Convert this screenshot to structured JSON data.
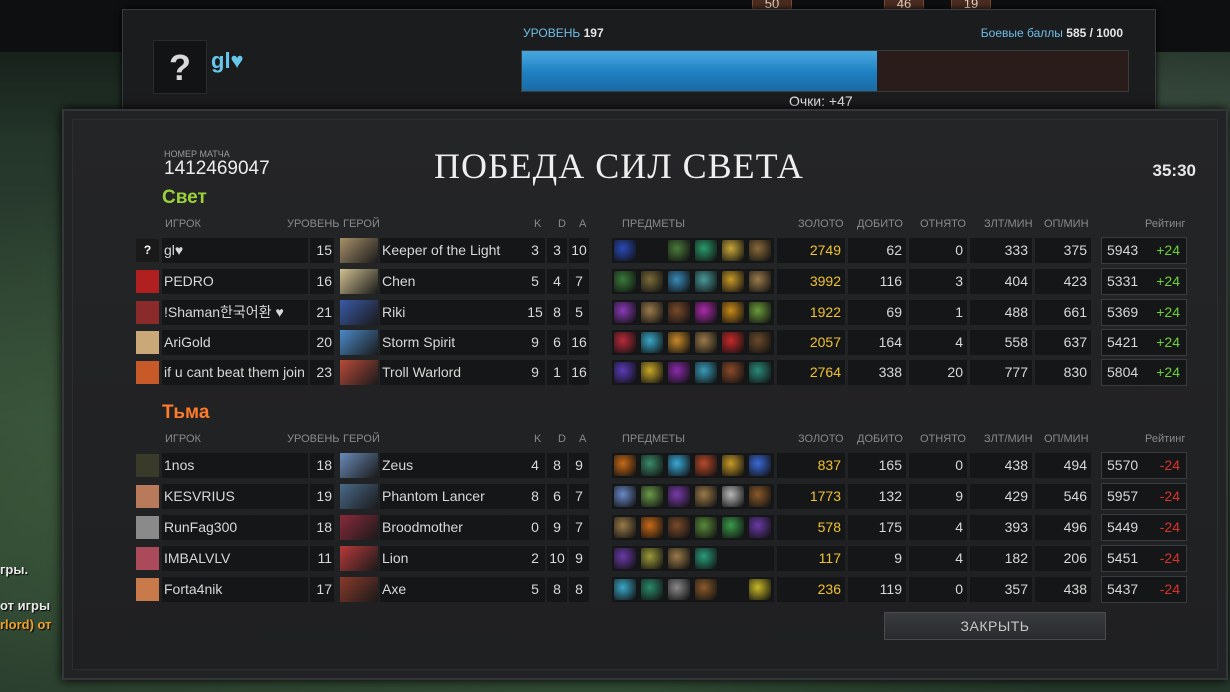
{
  "chat": {
    "lines": [
      "гры.",
      "от игры",
      "rlord) от"
    ]
  },
  "top_badges": [
    "50",
    "46",
    "19"
  ],
  "profile": {
    "avatar_glyph": "?",
    "name": "gl♥",
    "level_label": "УРОВЕНЬ",
    "level_value": "197",
    "battle_label": "Боевые баллы",
    "battle_value": "585 / 1000",
    "xp_progress": 0.585,
    "points_text": "Очки: +47"
  },
  "match": {
    "id_caption": "НОМЕР МАТЧА",
    "id": "1412469047",
    "title": "ПОБЕДА СИЛ СВЕТА",
    "duration": "35:30"
  },
  "columns": {
    "player": "ИГРОК",
    "level": "УРОВЕНЬ",
    "hero": "ГЕРОЙ",
    "k": "K",
    "d": "D",
    "a": "A",
    "items": "ПРЕДМЕТЫ",
    "gold": "ЗОЛОТО",
    "last_hits": "ДОБИТО",
    "denies": "ОТНЯТО",
    "gpm": "ЗЛТ/МИН",
    "xpm": "ОП/МИН",
    "rating": "Рейтинг"
  },
  "radiant": {
    "title": "Свет",
    "players": [
      {
        "avatar": "?",
        "name": "gl♥",
        "level": "15",
        "hero": "Keeper of the Light",
        "k": "3",
        "d": "3",
        "a": "10",
        "gold": "2749",
        "lh": "62",
        "dn": "0",
        "gpm": "333",
        "xpm": "375",
        "rating": "5943",
        "delta": "+24",
        "avatar_color": "#1a1a1a",
        "hero_color": "#a8906a",
        "items": [
          "#2a4ab8",
          "",
          "#4a7a3a",
          "#2a9a6a",
          "#c8a838",
          "#8a6a3a"
        ]
      },
      {
        "avatar": "",
        "name": "PEDRO",
        "level": "16",
        "hero": "Chen",
        "k": "5",
        "d": "4",
        "a": "7",
        "gold": "3992",
        "lh": "116",
        "dn": "3",
        "gpm": "404",
        "xpm": "423",
        "rating": "5331",
        "delta": "+24",
        "avatar_color": "#b02020",
        "hero_color": "#d0c090",
        "items": [
          "#3a7a3a",
          "#7a6a3a",
          "#3a8ab8",
          "#4a9a9a",
          "#c89a28",
          "#9a7a4a"
        ]
      },
      {
        "avatar": "",
        "name": "!Shaman한국어환 ♥",
        "level": "21",
        "hero": "Riki",
        "k": "15",
        "d": "8",
        "a": "5",
        "gold": "1922",
        "lh": "69",
        "dn": "1",
        "gpm": "488",
        "xpm": "661",
        "rating": "5369",
        "delta": "+24",
        "avatar_color": "#8a2a2a",
        "hero_color": "#3a5aa8",
        "items": [
          "#8a3ab8",
          "#9a7a4a",
          "#7a4a2a",
          "#aa2aaa",
          "#c88a18",
          "#6a9a3a"
        ]
      },
      {
        "avatar": "",
        "name": "AriGold",
        "level": "20",
        "hero": "Storm Spirit",
        "k": "9",
        "d": "6",
        "a": "16",
        "gold": "2057",
        "lh": "164",
        "dn": "4",
        "gpm": "558",
        "xpm": "637",
        "rating": "5421",
        "delta": "+24",
        "avatar_color": "#caa878",
        "hero_color": "#4a8ac8",
        "items": [
          "#b82a3a",
          "#3aa8c8",
          "#c88a28",
          "#9a7a4a",
          "#c82a2a",
          "#6a4a2a"
        ]
      },
      {
        "avatar": "",
        "name": "if u cant beat them join",
        "level": "23",
        "hero": "Troll Warlord",
        "k": "9",
        "d": "1",
        "a": "16",
        "gold": "2764",
        "lh": "338",
        "dn": "20",
        "gpm": "777",
        "xpm": "830",
        "rating": "5804",
        "delta": "+24",
        "avatar_color": "#c85a2a",
        "hero_color": "#b84a3a",
        "items": [
          "#5a3ab8",
          "#c8a828",
          "#8a2aaa",
          "#3a9ab8",
          "#8a4a2a",
          "#2a8a7a"
        ]
      }
    ]
  },
  "dire": {
    "title": "Тьма",
    "players": [
      {
        "avatar": "",
        "name": "1nos",
        "level": "18",
        "hero": "Zeus",
        "k": "4",
        "d": "8",
        "a": "9",
        "gold": "837",
        "lh": "165",
        "dn": "0",
        "gpm": "438",
        "xpm": "494",
        "rating": "5570",
        "delta": "-24",
        "avatar_color": "#3a3a2a",
        "hero_color": "#6a8ab8",
        "items": [
          "#c86a18",
          "#3a8a6a",
          "#3aa8d8",
          "#b84a2a",
          "#c89a28",
          "#3a6ad8"
        ]
      },
      {
        "avatar": "",
        "name": "KESVRIUS",
        "level": "19",
        "hero": "Phantom Lancer",
        "k": "8",
        "d": "6",
        "a": "7",
        "gold": "1773",
        "lh": "132",
        "dn": "9",
        "gpm": "429",
        "xpm": "546",
        "rating": "5957",
        "delta": "-24",
        "avatar_color": "#b87a5a",
        "hero_color": "#4a6a8a",
        "items": [
          "#6a8ac8",
          "#6a9a4a",
          "#7a3aaa",
          "#9a7a4a",
          "#b8b8b8",
          "#8a5a2a"
        ]
      },
      {
        "avatar": "",
        "name": "RunFag300",
        "level": "18",
        "hero": "Broodmother",
        "k": "0",
        "d": "9",
        "a": "7",
        "gold": "578",
        "lh": "175",
        "dn": "4",
        "gpm": "393",
        "xpm": "496",
        "rating": "5449",
        "delta": "-24",
        "avatar_color": "#8a8a8a",
        "hero_color": "#8a2a3a",
        "items": [
          "#9a7a4a",
          "#c86a18",
          "#7a4a2a",
          "#5a8a3a",
          "#3a9a4a",
          "#6a3aa8"
        ]
      },
      {
        "avatar": "",
        "name": "IMBALVLV",
        "level": "11",
        "hero": "Lion",
        "k": "2",
        "d": "10",
        "a": "9",
        "gold": "117",
        "lh": "9",
        "dn": "4",
        "gpm": "182",
        "xpm": "206",
        "rating": "5451",
        "delta": "-24",
        "avatar_color": "#aa4a5a",
        "hero_color": "#b83a3a",
        "items": [
          "#6a3aa8",
          "#9a9a3a",
          "#9a7a4a",
          "#2a9a7a",
          "",
          ""
        ]
      },
      {
        "avatar": "",
        "name": "Forta4nik",
        "level": "17",
        "hero": "Axe",
        "k": "5",
        "d": "8",
        "a": "8",
        "gold": "236",
        "lh": "119",
        "dn": "0",
        "gpm": "357",
        "xpm": "438",
        "rating": "5437",
        "delta": "-24",
        "avatar_color": "#c87a4a",
        "hero_color": "#8a3a2a",
        "items": [
          "#3aa8c8",
          "#2a8a6a",
          "#8a8a8a",
          "#8a5a2a",
          "",
          "#c8b828"
        ]
      }
    ]
  },
  "close_button": "ЗАКРЫТЬ"
}
